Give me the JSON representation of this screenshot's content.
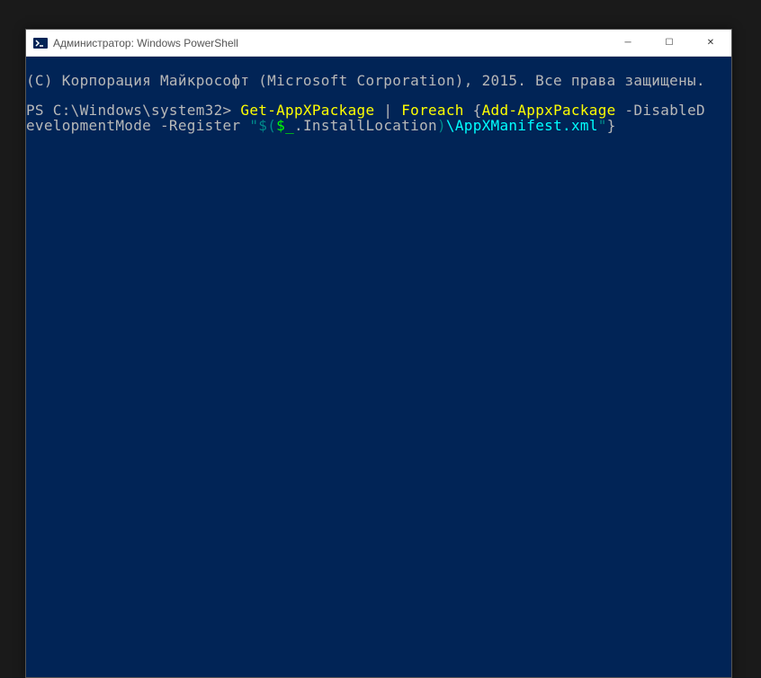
{
  "window": {
    "title": "Администратор: Windows PowerShell"
  },
  "terminal": {
    "copyright_line": "(C) Корпорация Майкрософт (Microsoft Corporation), 2015. Все права защищены.",
    "prompt": "PS C:\\Windows\\system32> ",
    "cmd": {
      "seg1": "Get-AppXPackage",
      "seg2": " | ",
      "seg3": "Foreach",
      "seg4": " {",
      "seg5": "Add-AppxPackage",
      "seg6": " -DisableD",
      "seg7": "evelopmentMode -Register ",
      "seg8": "\"$(",
      "seg9": "$_",
      "seg10": ".InstallLocation",
      "seg11": ")",
      "seg12": "\\AppXManifest.xml",
      "seg13": "\"",
      "seg14": "}"
    }
  },
  "controls": {
    "minimize": "─",
    "maximize": "☐",
    "close": "✕"
  }
}
